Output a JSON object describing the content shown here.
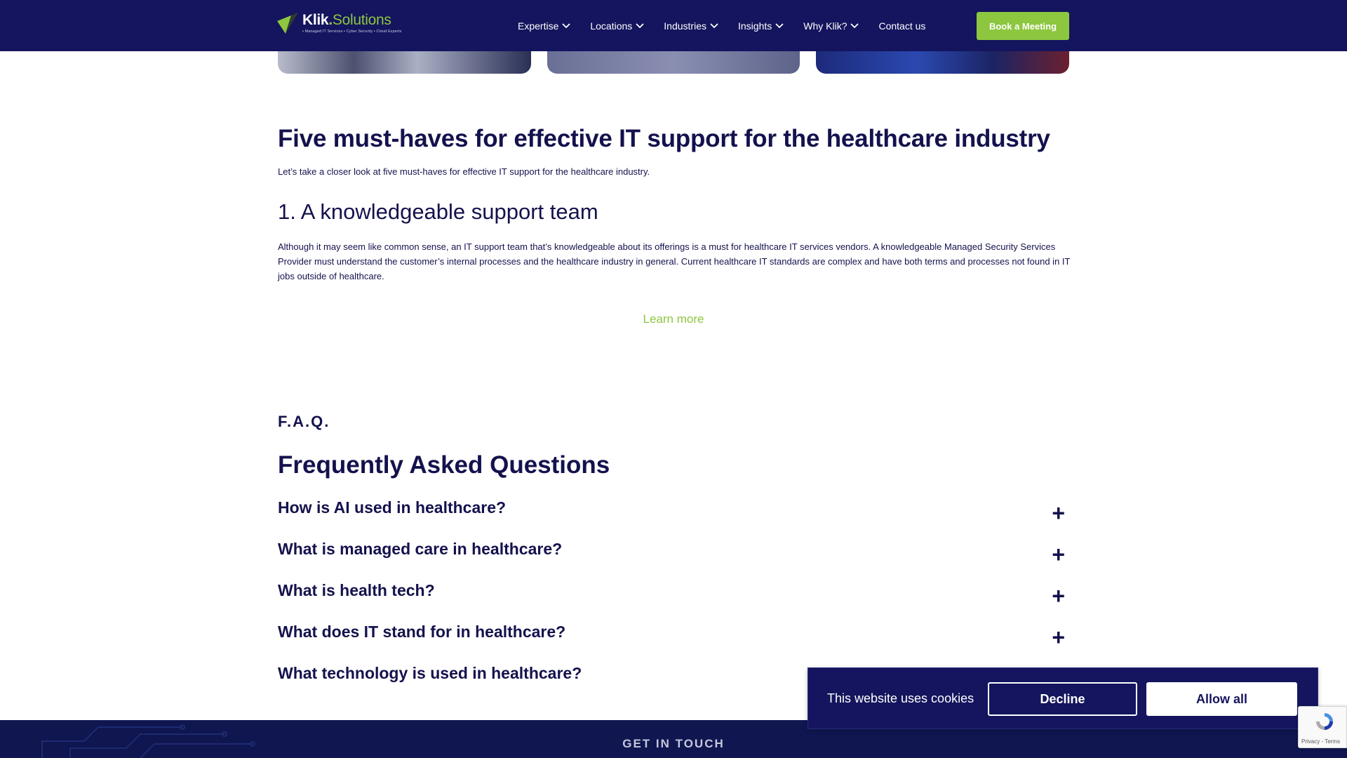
{
  "header": {
    "logo": {
      "name": "Klik",
      "dot": ".",
      "suffix": "Solutions",
      "tagline": "• Managed IT Services • Cyber Security • Cloud Experts"
    },
    "nav": [
      {
        "label": "Expertise",
        "has_dropdown": true
      },
      {
        "label": "Locations",
        "has_dropdown": true
      },
      {
        "label": "Industries",
        "has_dropdown": true
      },
      {
        "label": "Insights",
        "has_dropdown": true
      },
      {
        "label": "Why Klik?",
        "has_dropdown": true
      },
      {
        "label": "Contact us",
        "has_dropdown": false
      }
    ],
    "cta": "Book a Meeting"
  },
  "article": {
    "title": "Five must-haves for effective IT support for the healthcare industry",
    "intro": "Let’s take a closer look at five must-haves for effective IT support for the healthcare industry.",
    "section_title": "1. A knowledgeable support team",
    "section_body": "Although it may seem like common sense, an IT support team that’s knowledgeable about its offerings is a must for healthcare IT services vendors. A knowledgeable Managed Security Services Provider must understand the customer’s internal processes and the healthcare industry in general. Current healthcare IT standards are complex and have both terms and processes not found in IT jobs outside of healthcare.",
    "learn_more": "Learn more"
  },
  "faq": {
    "kicker": "F.A.Q.",
    "title": "Frequently Asked Questions",
    "items": [
      {
        "question": "How is AI used in healthcare?",
        "toggle": "+"
      },
      {
        "question": "What is managed care in healthcare?",
        "toggle": "+"
      },
      {
        "question": "What is health tech?",
        "toggle": "+"
      },
      {
        "question": "What does IT stand for in healthcare?",
        "toggle": "+"
      },
      {
        "question": "What technology is used in healthcare?",
        "toggle": "+"
      }
    ]
  },
  "footer": {
    "label": "GET IN TOUCH"
  },
  "cookie_banner": {
    "text": "This website uses cookies",
    "decline": "Decline",
    "allow": "Allow all"
  },
  "recaptcha": {
    "links": "Privacy - Terms"
  },
  "colors": {
    "navy": "#14155e",
    "text": "#14124d",
    "accent_green": "#8dc63f",
    "white": "#ffffff"
  }
}
